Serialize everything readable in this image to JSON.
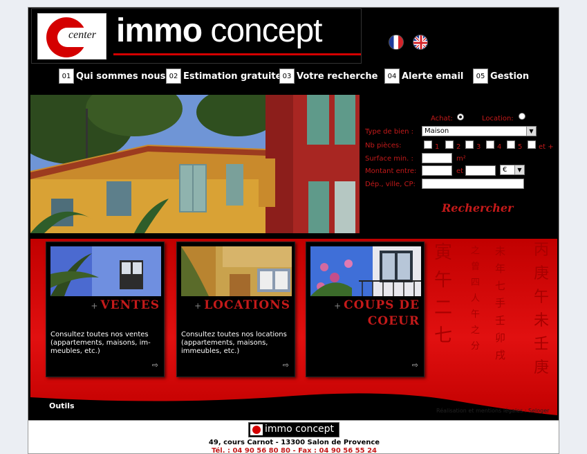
{
  "brand": {
    "logo_mark_text": "center",
    "name_bold": "immo",
    "name_regular": " concept"
  },
  "colors": {
    "accent_red": "#c41a1a",
    "band_red": "#e11010",
    "background": "#000000"
  },
  "languages": [
    {
      "name": "flag-fr-icon"
    },
    {
      "name": "flag-uk-icon"
    }
  ],
  "nav": [
    {
      "num": "01",
      "label": "Qui sommes nous"
    },
    {
      "num": "02",
      "label": "Estimation gratuite"
    },
    {
      "num": "03",
      "label": "Votre recherche"
    },
    {
      "num": "04",
      "label": "Alerte email"
    },
    {
      "num": "05",
      "label": "Gestion"
    }
  ],
  "search": {
    "achat_label": "Achat:",
    "location_label": "Location:",
    "transaction_selected": "Achat",
    "type_label": "Type de bien :",
    "type_value": "Maison",
    "pieces_label": "Nb pièces:",
    "pieces_options": [
      "1",
      "2",
      "3",
      "4",
      "5",
      "et +"
    ],
    "surface_label": "Surface min. :",
    "surface_unit": "m²",
    "montant_label": "Montant entre:",
    "montant_and": "et",
    "currency_value": "€",
    "location_field_label": "Dép., ville, CP:",
    "submit_label": "Rechercher"
  },
  "cards": [
    {
      "title": "VENTES",
      "desc": "Consultez toutes nos ventes (appartements, maisons, im-meubles, etc.)"
    },
    {
      "title": "LOCATIONS",
      "desc": "Consultez toutes nos locations (appartements, maisons, immeubles, etc.)"
    },
    {
      "title_line1": "COUPS DE",
      "title_line2": "COEUR"
    }
  ],
  "band_glyphs": {
    "col1": "寅\n午\n二\n七",
    "col2": "之\n曾\n四\n人\n午\n之\n分",
    "col3": "未\n年\n七\n手\n壬\n卯\n戌",
    "col4": "丙\n庚\n午\n未\n壬\n庚"
  },
  "outils_label": "Outils",
  "credits": "Réalisation et mentions légales : Seloger",
  "footer": {
    "logo_text": "immo concept",
    "address": "49, cours Carnot - 13300 Salon de Provence",
    "phone": "Tél. : 04 90 56 80 80 - Fax : 04 90 56 55 24"
  }
}
